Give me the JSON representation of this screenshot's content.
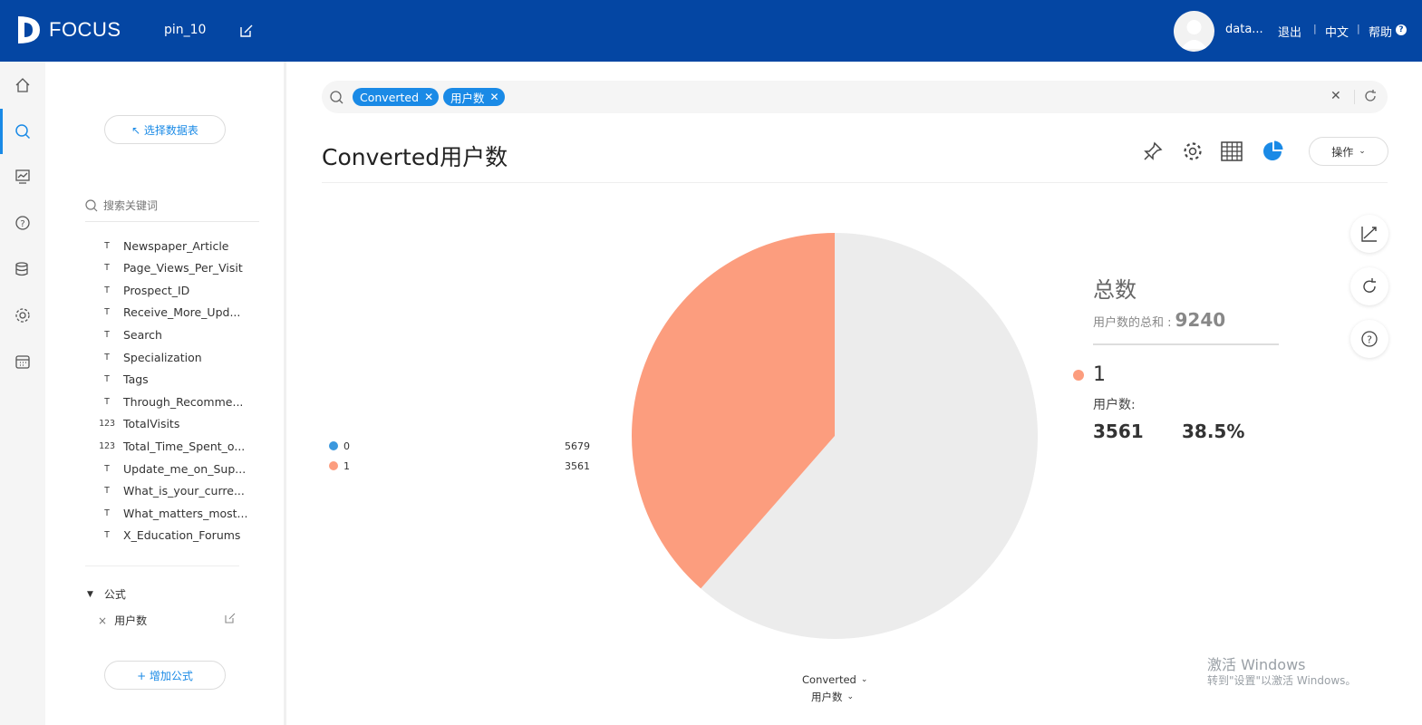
{
  "app": {
    "logo_text": "FOCUS",
    "pin_name": "pin_10",
    "user_name": "data...",
    "logout": "退出",
    "language": "中文",
    "help": "帮助"
  },
  "nav": {
    "icons": [
      "home-icon",
      "search-icon",
      "dashboard-icon",
      "help-icon",
      "database-icon",
      "settings-icon",
      "calendar-icon"
    ],
    "active": "search-icon"
  },
  "sidebar": {
    "select_table_button": "↖ 选择数据表",
    "search_placeholder": "搜索关键词",
    "fields": [
      {
        "type": "T",
        "name": "Newspaper_Article"
      },
      {
        "type": "T",
        "name": "Page_Views_Per_Visit"
      },
      {
        "type": "T",
        "name": "Prospect_ID"
      },
      {
        "type": "T",
        "name": "Receive_More_Upd..."
      },
      {
        "type": "T",
        "name": "Search"
      },
      {
        "type": "T",
        "name": "Specialization"
      },
      {
        "type": "T",
        "name": "Tags"
      },
      {
        "type": "T",
        "name": "Through_Recomme..."
      },
      {
        "type": "123",
        "name": "TotalVisits"
      },
      {
        "type": "123",
        "name": "Total_Time_Spent_o..."
      },
      {
        "type": "T",
        "name": "Update_me_on_Sup..."
      },
      {
        "type": "T",
        "name": "What_is_your_curre..."
      },
      {
        "type": "T",
        "name": "What_matters_most..."
      },
      {
        "type": "T",
        "name": "X_Education_Forums"
      }
    ],
    "formula_section": "公式",
    "formula_item": "用户数",
    "add_formula_button": "+ 增加公式"
  },
  "search": {
    "chips": [
      "Converted",
      "用户数"
    ]
  },
  "main": {
    "title": "Converted用户数",
    "operation_button": "操作"
  },
  "chart_data": {
    "type": "pie",
    "title": "Converted用户数",
    "categories": [
      "0",
      "1"
    ],
    "values": [
      5679,
      3561
    ],
    "colors": [
      "#ececec",
      "#fc9d7e"
    ],
    "legend_colors": [
      "#3a98de",
      "#fc9d7e"
    ],
    "legend_placement": "left",
    "total_label": "总数",
    "total_caption": "用户数的总和 :",
    "total_value": "9240",
    "selected": {
      "category": "1",
      "measure_label": "用户数:",
      "value": "3561",
      "percent": "38.5%"
    },
    "x_selector": "Converted",
    "y_selector": "用户数"
  },
  "watermark": {
    "line1": "激活 Windows",
    "line2": "转到\"设置\"以激活 Windows。"
  }
}
